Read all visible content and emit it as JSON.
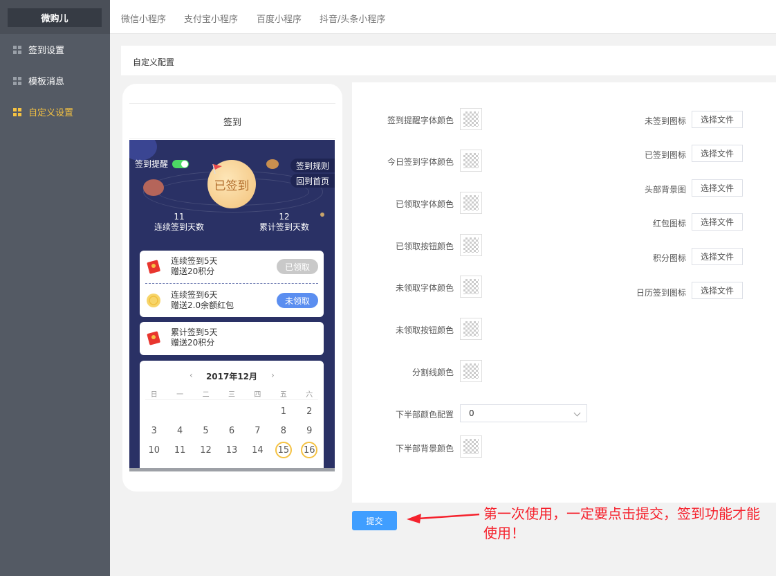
{
  "brand": "微购儿",
  "sidebar": {
    "items": [
      {
        "label": "签到设置",
        "active": false
      },
      {
        "label": "模板消息",
        "active": false
      },
      {
        "label": "自定义设置",
        "active": true
      }
    ]
  },
  "tabs": [
    "微信小程序",
    "支付宝小程序",
    "百度小程序",
    "抖音/头条小程序"
  ],
  "panel_title": "自定义配置",
  "preview": {
    "header": "签到",
    "remind_label": "签到提醒",
    "rules_btn": "签到规则",
    "home_btn": "回到首页",
    "signed_text": "已签到",
    "consecutive": {
      "value": "11",
      "label": "连续签到天数"
    },
    "total": {
      "value": "12",
      "label": "累计签到天数"
    },
    "rewards": [
      {
        "line1": "连续签到5天",
        "line2": "赠送20积分",
        "btn": "已领取",
        "icon": "red-packet-icon"
      },
      {
        "line1": "连续签到6天",
        "line2": "赠送2.0余额红包",
        "btn": "未领取",
        "icon": "coin-icon"
      }
    ],
    "total_reward": {
      "line1": "累计签到5天",
      "line2": "赠送20积分"
    },
    "calendar": {
      "month": "2017年12月",
      "weekdays": [
        "日",
        "一",
        "二",
        "三",
        "四",
        "五",
        "六"
      ],
      "rows": [
        [
          "",
          "",
          "",
          "",
          "",
          "1",
          "2"
        ],
        [
          "3",
          "4",
          "5",
          "6",
          "7",
          "8",
          "9"
        ],
        [
          "10",
          "11",
          "12",
          "13",
          "14",
          "15",
          "16"
        ]
      ]
    }
  },
  "form": {
    "color_fields": [
      "签到提醒字体颜色",
      "今日签到字体颜色",
      "已领取字体颜色",
      "已领取按钮颜色",
      "未领取字体颜色",
      "未领取按钮颜色",
      "分割线颜色"
    ],
    "bottom_config_label": "下半部颜色配置",
    "bottom_config_value": "0",
    "bottom_bg_label": "下半部背景颜色",
    "file_fields": [
      "未签到图标",
      "已签到图标",
      "头部背景图",
      "红包图标",
      "积分图标",
      "日历签到图标"
    ],
    "file_btn": "选择文件"
  },
  "submit": "提交",
  "annotation": "第一次使用，一定要点击提交，签到功能才能使用！",
  "colors": {
    "sidebar": "#545a64",
    "accent": "#f5c242",
    "primary": "#409eff",
    "annotation": "#f5222d"
  }
}
